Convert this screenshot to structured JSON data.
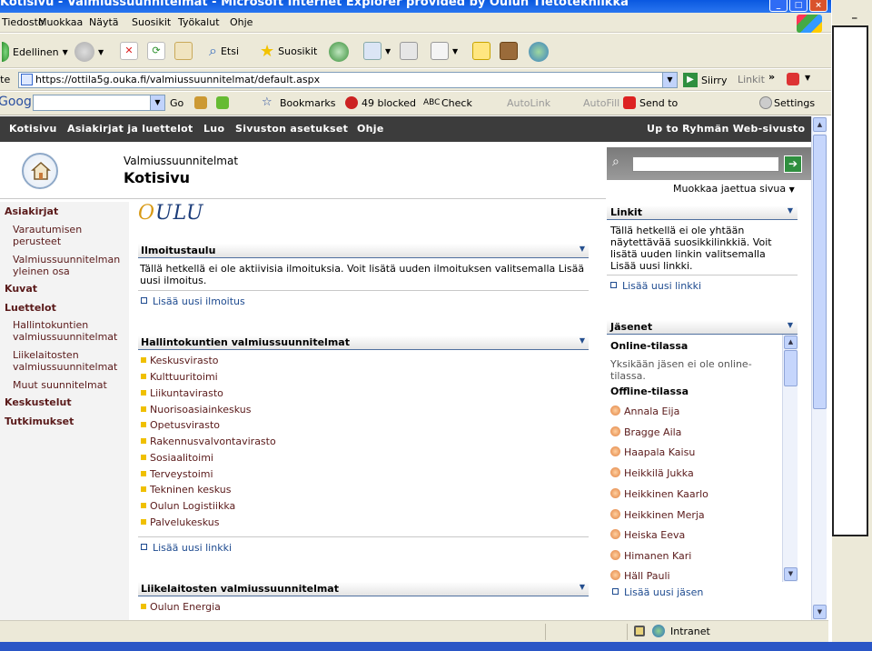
{
  "window": {
    "title": "Kotisivu - Valmiussuunnitelmat - Microsoft Internet Explorer provided by Oulun Tietotekniikka"
  },
  "menu": [
    "Tiedosto",
    "Muokkaa",
    "Näytä",
    "Suosikit",
    "Työkalut",
    "Ohje"
  ],
  "toolbar": {
    "back": "Edellinen",
    "search": "Etsi",
    "favorites": "Suosikit"
  },
  "address": {
    "label": "Osoite",
    "url": "https://ottila5g.ouka.fi/valmiussuunnitelmat/default.aspx",
    "go": "Siirry",
    "links": "Linkit"
  },
  "google": {
    "logo": "Google",
    "go": "Go",
    "bookmarks": "Bookmarks",
    "blocked": "49 blocked",
    "check": "Check",
    "autolink": "AutoLink",
    "autofill": "AutoFill",
    "sendto": "Send to",
    "settings": "Settings"
  },
  "nav": {
    "items": [
      "Kotisivu",
      "Asiakirjat ja luettelot",
      "Luo",
      "Sivuston asetukset",
      "Ohje"
    ],
    "up": "Up to Ryhmän Web-sivusto"
  },
  "header": {
    "site_name": "Valmiussuunnitelmat",
    "page_title": "Kotisivu",
    "edit_shared": "Muokkaa jaettua sivua"
  },
  "sidebar": {
    "asiakirjat": "Asiakirjat",
    "varautumisen": "Varautumisen perusteet",
    "yleinen": "Valmiussuunnitelman yleinen osa",
    "kuvat": "Kuvat",
    "luettelot": "Luettelot",
    "hallinto": "Hallintokuntien valmiussuunnitelmat",
    "liikelaitosten": "Liikelaitosten valmiussuunnitelmat",
    "muut": "Muut suunnitelmat",
    "keskustelut": "Keskustelut",
    "tutkimukset": "Tutkimukset"
  },
  "logo": {
    "o": "O",
    "rest": "ULU"
  },
  "announcements": {
    "title": "Ilmoitustaulu",
    "text": "Tällä hetkellä ei ole aktiivisia ilmoituksia. Voit lisätä uuden ilmoituksen valitsemalla Lisää uusi ilmoitus.",
    "add": "Lisää uusi ilmoitus"
  },
  "hallinto_list": {
    "title": "Hallintokuntien valmiussuunnitelmat",
    "items": [
      "Keskusvirasto",
      "Kulttuuritoimi",
      "Liikuntavirasto",
      "Nuorisoasiainkeskus",
      "Opetusvirasto",
      "Rakennusvalvontavirasto",
      "Sosiaalitoimi",
      "Terveystoimi",
      "Tekninen keskus",
      "Oulun Logistiikka",
      "Palvelukeskus"
    ],
    "add": "Lisää uusi linkki"
  },
  "liikelaitos_list": {
    "title": "Liikelaitosten valmiussuunnitelmat",
    "items": [
      "Oulun Energia"
    ]
  },
  "links_panel": {
    "title": "Linkit",
    "text": "Tällä hetkellä ei ole yhtään näytettävää suosikkilinkkiä. Voit lisätä uuden linkin valitsemalla Lisää uusi linkki.",
    "add": "Lisää uusi linkki"
  },
  "members": {
    "title": "Jäsenet",
    "online_title": "Online-tilassa",
    "online_text": "Yksikään jäsen ei ole online-tilassa.",
    "offline_title": "Offline-tilassa",
    "offline": [
      "Annala Eija",
      "Bragge Aila",
      "Haapala Kaisu",
      "Heikkilä Jukka",
      "Heikkinen Kaarlo",
      "Heikkinen Merja",
      "Heiska Eeva",
      "Himanen Kari",
      "Häll Pauli"
    ],
    "add": "Lisää uusi jäsen"
  },
  "status": {
    "zone": "Intranet"
  },
  "icons": [
    "home-icon",
    "search-icon",
    "go-arrow-icon",
    "lock-icon",
    "globe-icon",
    "person-icon"
  ],
  "colors": {
    "nav_bg": "#3c3c3c",
    "link": "#1d4a8f",
    "bullet": "#f0c000",
    "title_bar": "#0a58e0"
  }
}
